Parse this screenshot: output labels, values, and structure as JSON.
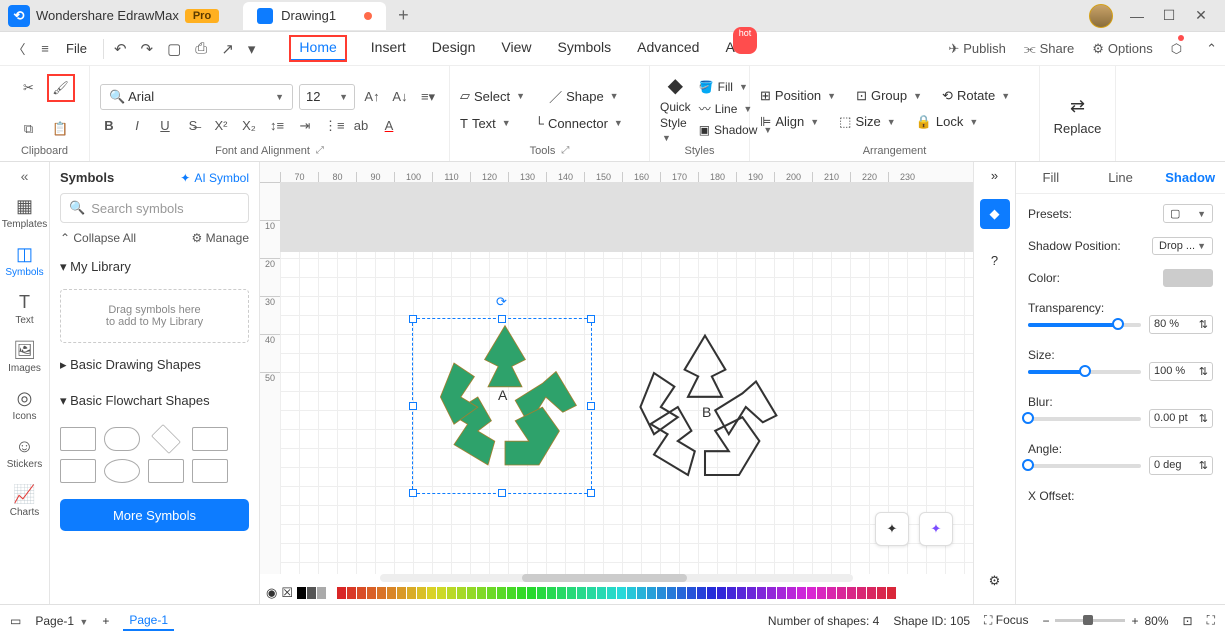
{
  "app": {
    "name": "Wondershare EdrawMax",
    "badge": "Pro"
  },
  "doc_tab": {
    "title": "Drawing1"
  },
  "menu": {
    "file": "File",
    "tabs": [
      "Home",
      "Insert",
      "Design",
      "View",
      "Symbols",
      "Advanced",
      "AI"
    ],
    "active": "Home",
    "hot": "hot",
    "publish": "Publish",
    "share": "Share",
    "options": "Options"
  },
  "ribbon": {
    "clipboard": "Clipboard",
    "font_align": "Font and Alignment",
    "tools": "Tools",
    "styles": "Styles",
    "arrangement": "Arrangement",
    "font_name": "Arial",
    "font_size": "12",
    "select": "Select",
    "shape": "Shape",
    "text": "Text",
    "connector": "Connector",
    "quick_style": "Quick Style",
    "fill": "Fill",
    "line": "Line",
    "shadow": "Shadow",
    "position": "Position",
    "group": "Group",
    "rotate": "Rotate",
    "align": "Align",
    "size": "Size",
    "lock": "Lock",
    "replace": "Replace"
  },
  "left_dock": {
    "templates": "Templates",
    "symbols": "Symbols",
    "text": "Text",
    "images": "Images",
    "icons": "Icons",
    "stickers": "Stickers",
    "charts": "Charts"
  },
  "sympanel": {
    "title": "Symbols",
    "ai": "AI Symbol",
    "search_ph": "Search symbols",
    "collapse": "Collapse All",
    "manage": "Manage",
    "mylib": "My Library",
    "drop1": "Drag symbols here",
    "drop2": "to add to My Library",
    "sec_basic": "Basic Drawing Shapes",
    "sec_flow": "Basic Flowchart Shapes",
    "more": "More Symbols"
  },
  "ruler_h": [
    "70",
    "80",
    "90",
    "100",
    "110",
    "120",
    "130",
    "140",
    "150",
    "160",
    "170",
    "180",
    "190",
    "200",
    "210",
    "220",
    "230"
  ],
  "ruler_v": [
    "",
    "10",
    "20",
    "30",
    "40",
    "50"
  ],
  "canvas": {
    "label_a": "A",
    "label_b": "B"
  },
  "rpanel": {
    "tabs": {
      "fill": "Fill",
      "line": "Line",
      "shadow": "Shadow"
    },
    "presets": "Presets:",
    "shadow_pos": "Shadow Position:",
    "shadow_pos_val": "Drop ...",
    "color": "Color:",
    "transparency": "Transparency:",
    "transparency_val": "80 %",
    "size": "Size:",
    "size_val": "100 %",
    "blur": "Blur:",
    "blur_val": "0.00 pt",
    "angle": "Angle:",
    "angle_val": "0 deg",
    "xoffset": "X Offset:"
  },
  "status": {
    "page_sel": "Page-1",
    "page_tab": "Page-1",
    "shapes": "Number of shapes: 4",
    "shape_id": "Shape ID:   105",
    "focus": "Focus",
    "zoom": "80%"
  }
}
